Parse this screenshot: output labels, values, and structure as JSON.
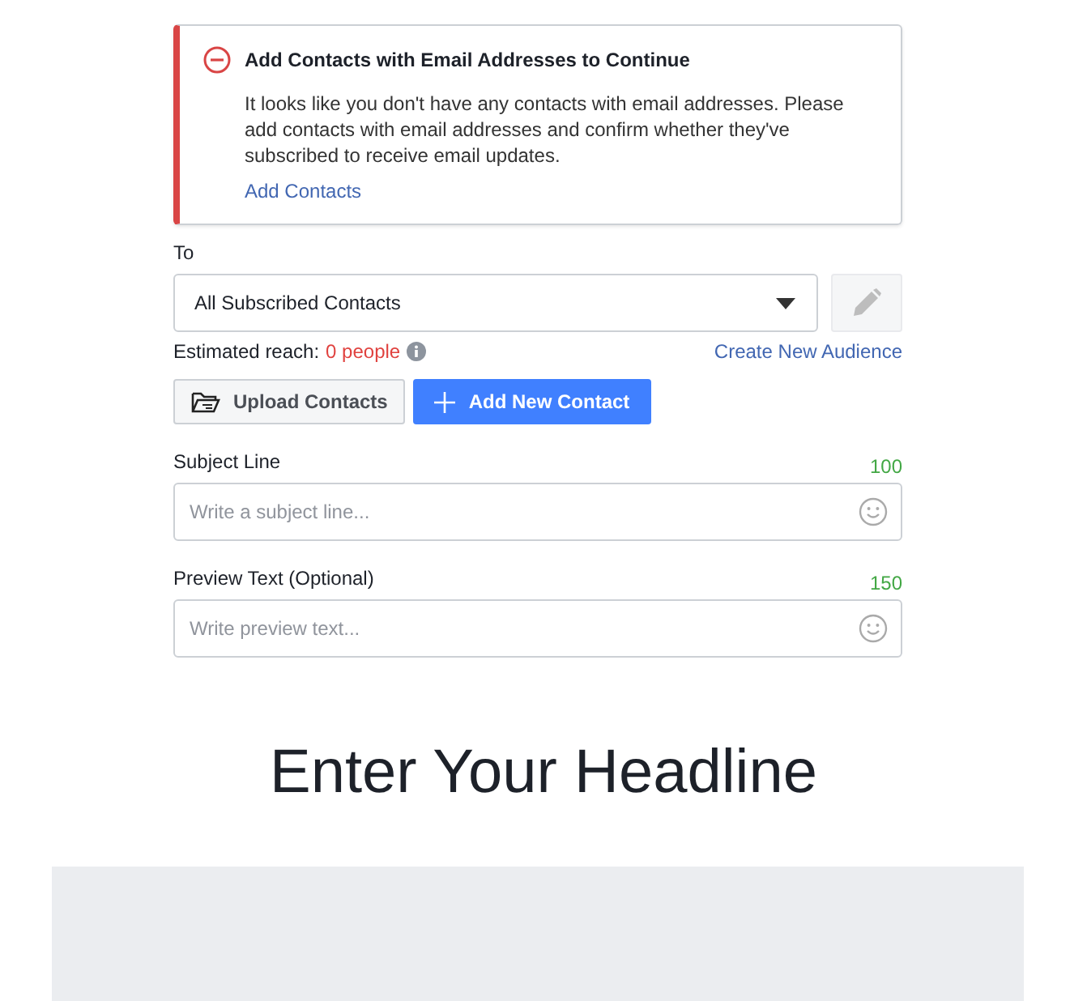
{
  "alert": {
    "title": "Add Contacts with Email Addresses to Continue",
    "message": "It looks like you don't have any contacts with email addresses. Please add contacts with email addresses and confirm whether they've subscribed to receive email updates.",
    "link": "Add Contacts"
  },
  "audience": {
    "label": "To",
    "value": "All Subscribed Contacts",
    "reach_label": "Estimated reach:",
    "reach_value": "0 people",
    "create_link": "Create New Audience"
  },
  "buttons": [
    {
      "label": "Upload Contacts",
      "kind": "secondary"
    },
    {
      "label": "Add New Contact",
      "kind": "primary"
    }
  ],
  "fields": [
    {
      "label": "Subject Line",
      "count": "100",
      "placeholder": "Write a subject line..."
    },
    {
      "label": "Preview Text (Optional)",
      "count": "150",
      "placeholder": "Write preview text..."
    }
  ],
  "headline": "Enter Your Headline"
}
